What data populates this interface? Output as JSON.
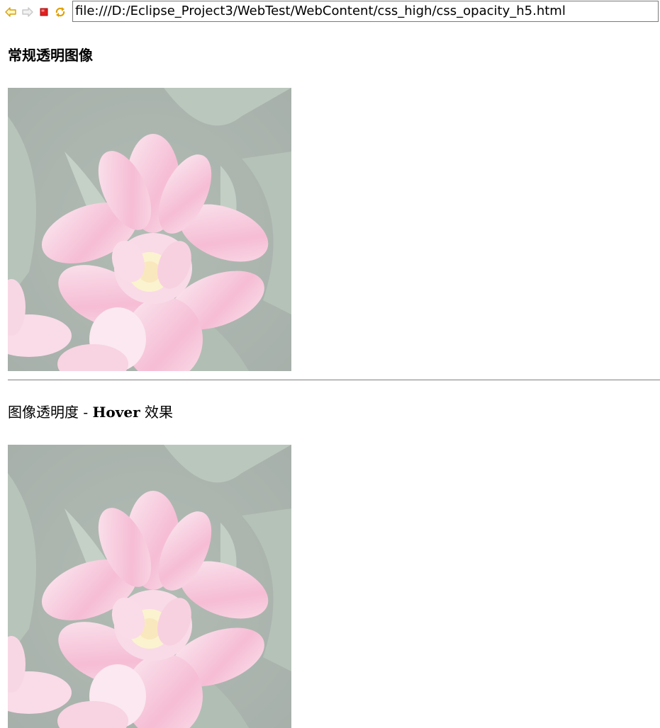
{
  "browser": {
    "back_icon": "back-arrow-icon",
    "forward_icon": "forward-arrow-icon",
    "stop_icon": "stop-icon",
    "refresh_icon": "refresh-icon",
    "url": "file:///D:/Eclipse_Project3/WebTest/WebContent/css_high/css_opacity_h5.html"
  },
  "page": {
    "heading_regular": "常规透明图像",
    "heading_hover_part1": "图像透明度 - ",
    "heading_hover_part2": "Hover",
    "heading_hover_part3": " 效果",
    "image_opacity": 0.4,
    "image_subject": "pink tulip flower photo"
  },
  "colors": {
    "arrow": "#d4a017",
    "stop": "#e02020",
    "refresh": "#e0a000",
    "divider": "#808080"
  }
}
